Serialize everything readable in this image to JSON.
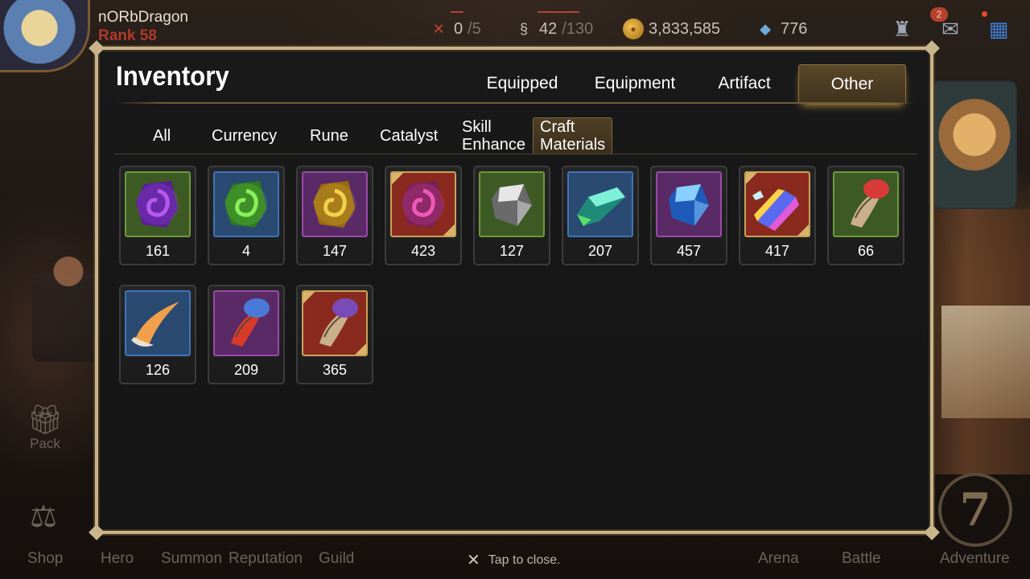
{
  "player": {
    "name": "nORbDragon",
    "rank": "Rank 58"
  },
  "resources": {
    "stamina": {
      "value": "0",
      "max": "/5"
    },
    "energy": {
      "value": "42",
      "max": "/130"
    },
    "gold": "3,833,585",
    "gems": "776"
  },
  "notifications": {
    "mail_count": "2"
  },
  "inventory": {
    "title": "Inventory",
    "main_tabs": [
      {
        "label": "Equipped",
        "active": false
      },
      {
        "label": "Equipment",
        "active": false
      },
      {
        "label": "Artifact",
        "active": false
      },
      {
        "label": "Other",
        "active": true
      }
    ],
    "sub_tabs": [
      {
        "label": "All"
      },
      {
        "label": "Currency"
      },
      {
        "label": "Rune"
      },
      {
        "label": "Catalyst"
      },
      {
        "label_line1": "Skill",
        "label_line2": "Enhance"
      },
      {
        "label_line1": "Craft",
        "label_line2": "Materials",
        "active": true
      }
    ],
    "items": [
      {
        "name": "purple-rune-stone",
        "count": "161",
        "frame": "#6f9a3a",
        "bg": "#3d5a24"
      },
      {
        "name": "green-rune-stone",
        "count": "4",
        "frame": "#3f74b8",
        "bg": "#2a4a72"
      },
      {
        "name": "yellow-rune-stone",
        "count": "147",
        "frame": "#9a4aa8",
        "bg": "#5a2a66"
      },
      {
        "name": "magenta-rune-stone",
        "count": "423",
        "frame": "#c9a25a",
        "bg": "#8a2a1e"
      },
      {
        "name": "grey-crystal",
        "count": "127",
        "frame": "#6f9a3a",
        "bg": "#3d5a24"
      },
      {
        "name": "teal-crystal",
        "count": "207",
        "frame": "#3f74b8",
        "bg": "#2a4a72"
      },
      {
        "name": "blue-crystal",
        "count": "457",
        "frame": "#9a4aa8",
        "bg": "#5a2a66"
      },
      {
        "name": "prism-crystal",
        "count": "417",
        "frame": "#c9a25a",
        "bg": "#8a2a1e"
      },
      {
        "name": "red-fur-claw",
        "count": "66",
        "frame": "#6f9a3a",
        "bg": "#3d5a24"
      },
      {
        "name": "orange-horn-claw",
        "count": "126",
        "frame": "#3f74b8",
        "bg": "#2a4a72"
      },
      {
        "name": "blue-fur-red-claw",
        "count": "209",
        "frame": "#9a4aa8",
        "bg": "#5a2a66"
      },
      {
        "name": "purple-fur-claw",
        "count": "365",
        "frame": "#c9a25a",
        "bg": "#8a2a1e"
      }
    ]
  },
  "bottom_nav": {
    "pack": "Pack",
    "shop": "Shop",
    "hero": "Hero",
    "summon": "Summon",
    "reputation": "Reputation",
    "guild": "Guild",
    "arena": "Arena",
    "battle": "Battle",
    "adventure": "Adventure",
    "adventure_emblem": "7"
  },
  "close_hint": "Tap to close."
}
